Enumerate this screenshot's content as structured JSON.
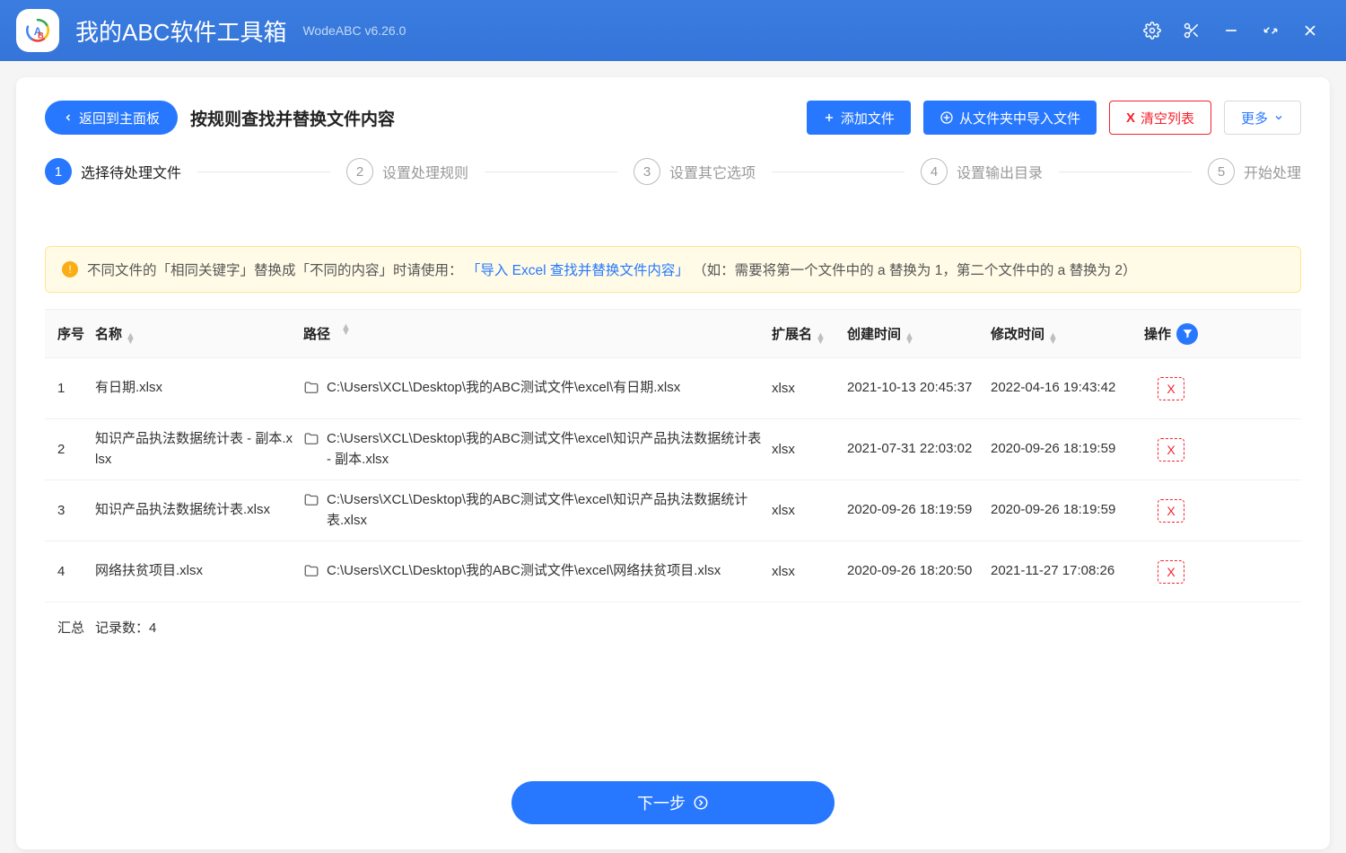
{
  "titleBar": {
    "appName": "我的ABC软件工具箱",
    "version": "WodeABC v6.26.0"
  },
  "header": {
    "back": "返回到主面板",
    "title": "按规则查找并替换文件内容",
    "addFile": "添加文件",
    "importFolder": "从文件夹中导入文件",
    "clear": "清空列表",
    "more": "更多"
  },
  "steps": [
    {
      "num": "1",
      "label": "选择待处理文件"
    },
    {
      "num": "2",
      "label": "设置处理规则"
    },
    {
      "num": "3",
      "label": "设置其它选项"
    },
    {
      "num": "4",
      "label": "设置输出目录"
    },
    {
      "num": "5",
      "label": "开始处理"
    }
  ],
  "alert": {
    "p1": "不同文件的「相同关键字」替换成「不同的内容」时请使用：",
    "link": "「导入 Excel 查找并替换文件内容」",
    "p2": "（如：需要将第一个文件中的 a 替换为 1，第二个文件中的 a 替换为 2）"
  },
  "cols": {
    "idx": "序号",
    "name": "名称",
    "path": "路径",
    "ext": "扩展名",
    "ctime": "创建时间",
    "mtime": "修改时间",
    "action": "操作"
  },
  "rows": [
    {
      "idx": "1",
      "name": "有日期.xlsx",
      "path": "C:\\Users\\XCL\\Desktop\\我的ABC测试文件\\excel\\有日期.xlsx",
      "ext": "xlsx",
      "ctime": "2021-10-13 20:45:37",
      "mtime": "2022-04-16 19:43:42"
    },
    {
      "idx": "2",
      "name": "知识产品执法数据统计表 - 副本.xlsx",
      "path": "C:\\Users\\XCL\\Desktop\\我的ABC测试文件\\excel\\知识产品执法数据统计表 - 副本.xlsx",
      "ext": "xlsx",
      "ctime": "2021-07-31 22:03:02",
      "mtime": "2020-09-26 18:19:59"
    },
    {
      "idx": "3",
      "name": "知识产品执法数据统计表.xlsx",
      "path": "C:\\Users\\XCL\\Desktop\\我的ABC测试文件\\excel\\知识产品执法数据统计表.xlsx",
      "ext": "xlsx",
      "ctime": "2020-09-26 18:19:59",
      "mtime": "2020-09-26 18:19:59"
    },
    {
      "idx": "4",
      "name": "网络扶贫项目.xlsx",
      "path": "C:\\Users\\XCL\\Desktop\\我的ABC测试文件\\excel\\网络扶贫项目.xlsx",
      "ext": "xlsx",
      "ctime": "2020-09-26 18:20:50",
      "mtime": "2021-11-27 17:08:26"
    }
  ],
  "summary": {
    "label": "汇总",
    "text": "记录数：4"
  },
  "next": "下一步"
}
